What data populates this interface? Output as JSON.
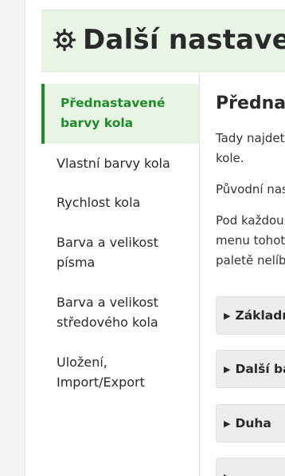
{
  "header": {
    "title": "Další nastavení",
    "icon": "gear-icon"
  },
  "sidebar": {
    "items": [
      {
        "line1": "Přednastavené",
        "line2": "barvy kola",
        "active": true
      },
      {
        "line1": "Vlastní barvy kola",
        "line2": "",
        "active": false
      },
      {
        "line1": "Rychlost kola",
        "line2": "",
        "active": false
      },
      {
        "line1": "Barva a velikost",
        "line2": "písma",
        "active": false
      },
      {
        "line1": "Barva a velikost",
        "line2": "středového kola",
        "active": false
      },
      {
        "line1": "Uložení,",
        "line2": "Import/Export",
        "active": false
      }
    ]
  },
  "content": {
    "heading": "Přednastavené barvy kola",
    "para1_line1": "Tady najdete přednastavené barvy na",
    "para1_line2": "kole.",
    "para2_line1": "Původní nastavení",
    "para3_line1": "Pod každou paletou je tlačítko, v",
    "para3_line2": "menu tohoto tlačítka si vyberete",
    "para3_line3": "paletě nelíbí",
    "accordions": [
      {
        "label": "Základní"
      },
      {
        "label": "Další barvy"
      },
      {
        "label": "Duha"
      },
      {
        "label": ""
      }
    ]
  },
  "colors": {
    "accent": "#1f8a2a",
    "header_bg": "#e8f5e4",
    "accordion_bg": "#ececec"
  }
}
